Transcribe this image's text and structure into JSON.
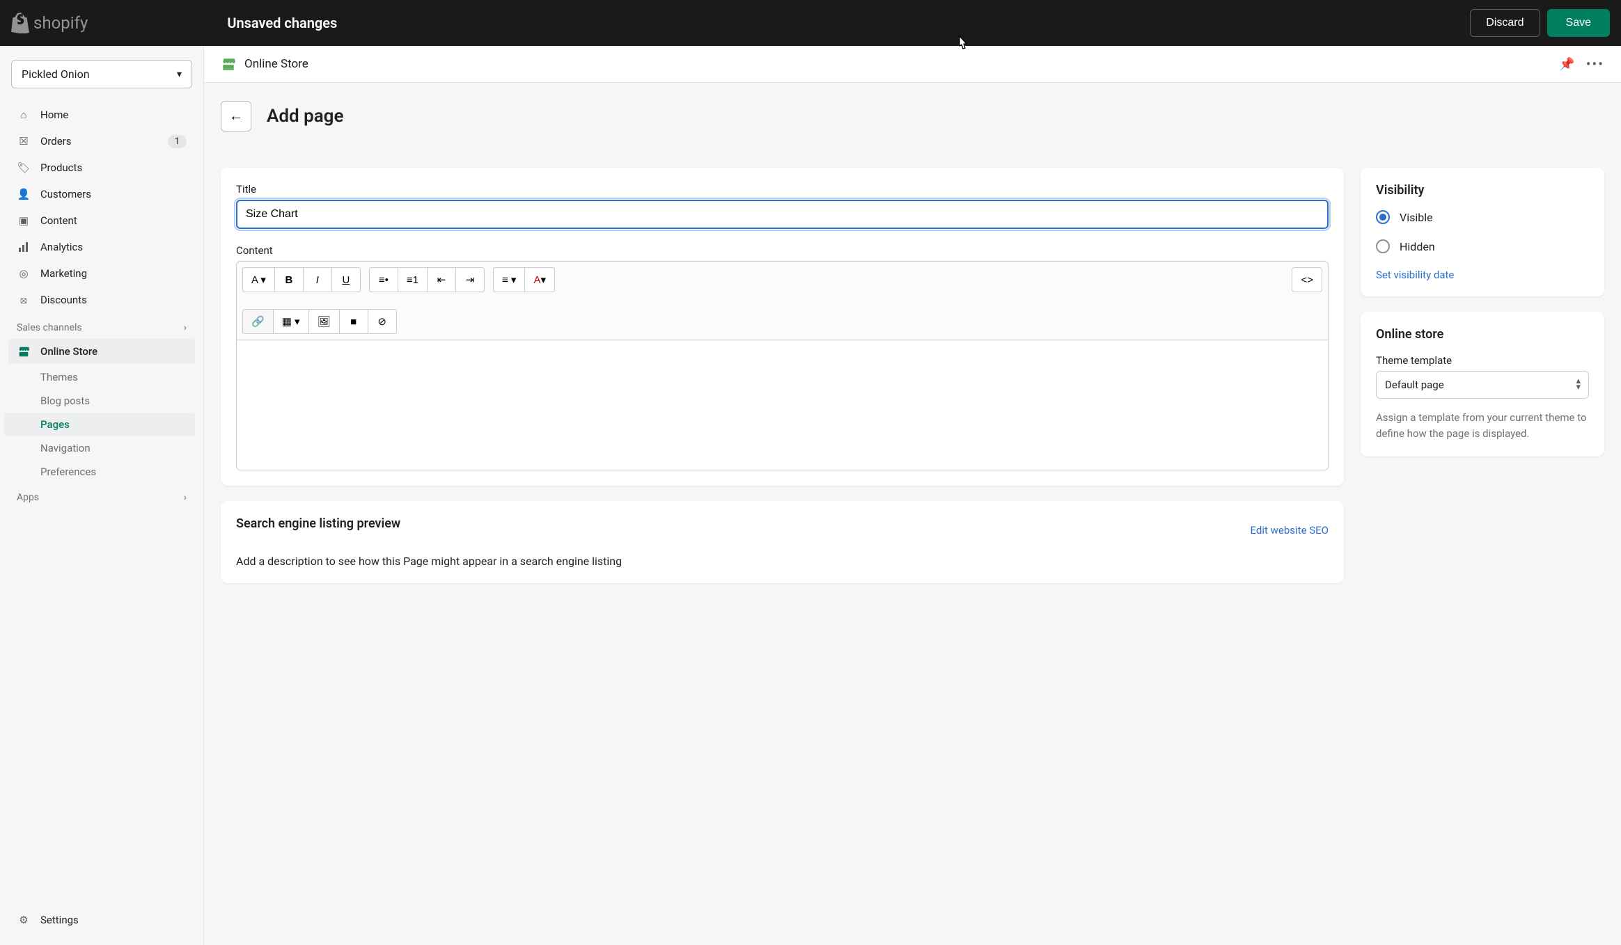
{
  "topbar": {
    "brand": "shopify",
    "unsaved": "Unsaved changes",
    "discard": "Discard",
    "save": "Save"
  },
  "sidebar": {
    "store": "Pickled Onion",
    "items": [
      {
        "label": "Home"
      },
      {
        "label": "Orders",
        "badge": "1"
      },
      {
        "label": "Products"
      },
      {
        "label": "Customers"
      },
      {
        "label": "Content"
      },
      {
        "label": "Analytics"
      },
      {
        "label": "Marketing"
      },
      {
        "label": "Discounts"
      }
    ],
    "sales_channels_label": "Sales channels",
    "online_store": "Online Store",
    "subs": [
      {
        "label": "Themes"
      },
      {
        "label": "Blog posts"
      },
      {
        "label": "Pages"
      },
      {
        "label": "Navigation"
      },
      {
        "label": "Preferences"
      }
    ],
    "apps_label": "Apps",
    "settings": "Settings"
  },
  "header": {
    "title": "Online Store"
  },
  "page": {
    "title": "Add page",
    "form": {
      "title_label": "Title",
      "title_value": "Size Chart",
      "content_label": "Content"
    },
    "seo": {
      "heading": "Search engine listing preview",
      "edit": "Edit website SEO",
      "desc": "Add a description to see how this Page might appear in a search engine listing"
    }
  },
  "visibility": {
    "heading": "Visibility",
    "visible": "Visible",
    "hidden": "Hidden",
    "set_date": "Set visibility date"
  },
  "online_store_card": {
    "heading": "Online store",
    "template_label": "Theme template",
    "template_value": "Default page",
    "help": "Assign a template from your current theme to define how the page is displayed."
  }
}
